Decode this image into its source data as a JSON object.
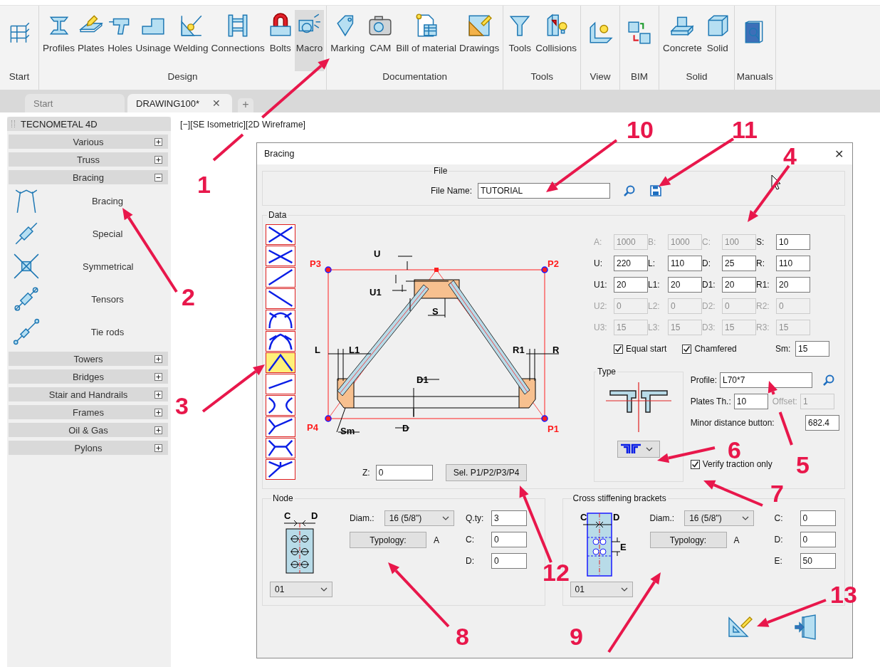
{
  "ribbon": {
    "groups": [
      {
        "label": "Start",
        "buttons": [
          {
            "selected": false
          }
        ]
      },
      {
        "label": "Design",
        "buttons": [
          {
            "label": "Profiles",
            "selected": false
          },
          {
            "label": "Plates",
            "selected": false
          },
          {
            "label": "Holes",
            "selected": false
          },
          {
            "label": "Usinage",
            "selected": false
          },
          {
            "label": "Welding",
            "selected": false
          },
          {
            "label": "Connections",
            "selected": false
          },
          {
            "label": "Bolts",
            "selected": false
          },
          {
            "label": "Macro",
            "selected": true
          }
        ]
      },
      {
        "label": "Documentation",
        "buttons": [
          {
            "label": "Marking",
            "selected": false
          },
          {
            "label": "CAM",
            "selected": false
          },
          {
            "label": "Bill of material",
            "selected": false
          },
          {
            "label": "Drawings",
            "selected": false
          }
        ]
      },
      {
        "label": "Tools",
        "buttons": [
          {
            "label": "Tools",
            "selected": false
          },
          {
            "label": "Collisions",
            "selected": false
          }
        ]
      },
      {
        "label": "View",
        "buttons": [
          {
            "selected": false
          }
        ]
      },
      {
        "label": "BIM",
        "buttons": [
          {
            "selected": false
          }
        ]
      },
      {
        "label": "Solid",
        "buttons": [
          {
            "label": "Concrete",
            "selected": false
          },
          {
            "label": "Solid",
            "selected": false
          }
        ]
      },
      {
        "label": "Manuals",
        "buttons": [
          {
            "selected": false
          }
        ]
      }
    ]
  },
  "tabs": {
    "items": [
      {
        "label": "Start",
        "selected": false
      },
      {
        "label": "DRAWING100*",
        "selected": true,
        "close": "✕"
      }
    ],
    "add": "+"
  },
  "sidebar": {
    "title": "TECNOMETAL 4D",
    "sections": [
      {
        "label": "Various",
        "expanded": false
      },
      {
        "label": "Truss",
        "expanded": false
      },
      {
        "label": "Bracing",
        "expanded": true,
        "items": [
          {
            "label": "Bracing"
          },
          {
            "label": "Special"
          },
          {
            "label": "Symmetrical"
          },
          {
            "label": "Tensors"
          },
          {
            "label": "Tie rods"
          }
        ]
      },
      {
        "label": "Towers",
        "expanded": false
      },
      {
        "label": "Bridges",
        "expanded": false
      },
      {
        "label": "Stair and Handrails",
        "expanded": false
      },
      {
        "label": "Frames",
        "expanded": false
      },
      {
        "label": "Oil & Gas",
        "expanded": false
      },
      {
        "label": "Pylons",
        "expanded": false
      }
    ]
  },
  "viewport": {
    "label": "[−][SE Isometric][2D Wireframe]"
  },
  "dialog": {
    "title": "Bracing",
    "close": "✕",
    "file": {
      "legend": "File",
      "label": "File Name:",
      "value": "TUTORIAL"
    },
    "data": {
      "legend": "Data",
      "types": [
        {
          "selected": false
        },
        {
          "selected": false
        },
        {
          "selected": false
        },
        {
          "selected": false
        },
        {
          "selected": false
        },
        {
          "selected": false
        },
        {
          "selected": true
        },
        {
          "selected": false
        },
        {
          "selected": false
        },
        {
          "selected": false
        },
        {
          "selected": false
        },
        {
          "selected": false
        }
      ],
      "diagram_labels": [
        "P3",
        "P2",
        "P4",
        "P1",
        "U",
        "U1",
        "S",
        "L",
        "L1",
        "R1",
        "R",
        "D1",
        "D",
        "Sm"
      ],
      "params": [
        {
          "label": "A:",
          "value": "1000",
          "disabled": true
        },
        {
          "label": "B:",
          "value": "1000",
          "disabled": true
        },
        {
          "label": "C:",
          "value": "100",
          "disabled": true
        },
        {
          "label": "S:",
          "value": "10",
          "disabled": false
        },
        {
          "label": "U:",
          "value": "220",
          "disabled": false
        },
        {
          "label": "L:",
          "value": "110",
          "disabled": false
        },
        {
          "label": "D:",
          "value": "25",
          "disabled": false
        },
        {
          "label": "R:",
          "value": "110",
          "disabled": false
        },
        {
          "label": "U1:",
          "value": "20",
          "disabled": false
        },
        {
          "label": "L1:",
          "value": "20",
          "disabled": false
        },
        {
          "label": "D1:",
          "value": "20",
          "disabled": false
        },
        {
          "label": "R1:",
          "value": "20",
          "disabled": false
        },
        {
          "label": "U2:",
          "value": "0",
          "disabled": true
        },
        {
          "label": "L2:",
          "value": "0",
          "disabled": true
        },
        {
          "label": "D2:",
          "value": "0",
          "disabled": true
        },
        {
          "label": "R2:",
          "value": "0",
          "disabled": true
        },
        {
          "label": "U3:",
          "value": "15",
          "disabled": true
        },
        {
          "label": "L3:",
          "value": "15",
          "disabled": true
        },
        {
          "label": "D3:",
          "value": "15",
          "disabled": true
        },
        {
          "label": "R3:",
          "value": "15",
          "disabled": true
        }
      ],
      "checkboxes": [
        {
          "label": "Equal start",
          "checked": true
        },
        {
          "label": "Chamfered",
          "checked": true
        }
      ],
      "sm": {
        "label": "Sm:",
        "value": "15"
      },
      "type": {
        "legend": "Type"
      },
      "profile": {
        "label": "Profile:",
        "value": "L70*7"
      },
      "plates": {
        "label": "Plates Th.:",
        "value": "10"
      },
      "offset": {
        "label": "Offset:",
        "value": "1",
        "disabled": true
      },
      "minor": {
        "label": "Minor distance button:",
        "value": "682.4"
      },
      "verify": {
        "label": "Verify traction only",
        "checked": true
      },
      "z": {
        "label": "Z:",
        "value": "0"
      },
      "select_button": "Sel. P1/P2/P3/P4"
    },
    "node": {
      "legend": "Node",
      "drawing_labels": [
        "C",
        "D"
      ],
      "diam_label": "Diam.:",
      "diam": "16 (5/8\")",
      "typology_button": "Typology:",
      "typology": "A",
      "fields": [
        {
          "label": "Q.ty:",
          "value": "3"
        },
        {
          "label": "C:",
          "value": "0"
        },
        {
          "label": "D:",
          "value": "0"
        }
      ],
      "variant": "01"
    },
    "brackets": {
      "legend": "Cross stiffening brackets",
      "drawing_labels": [
        "C",
        "D",
        "E"
      ],
      "diam_label": "Diam.:",
      "diam": "16 (5/8\")",
      "typology_button": "Typology:",
      "typology": "A",
      "fields": [
        {
          "label": "C:",
          "value": "0"
        },
        {
          "label": "D:",
          "value": "0"
        },
        {
          "label": "E:",
          "value": "50"
        }
      ],
      "variant": "01"
    }
  },
  "annotations": [
    {
      "label": "1"
    },
    {
      "label": "2"
    },
    {
      "label": "3"
    },
    {
      "label": "4"
    },
    {
      "label": "5"
    },
    {
      "label": "6"
    },
    {
      "label": "7"
    },
    {
      "label": "8"
    },
    {
      "label": "9"
    },
    {
      "label": "10"
    },
    {
      "label": "11"
    },
    {
      "label": "12"
    },
    {
      "label": "13"
    }
  ]
}
